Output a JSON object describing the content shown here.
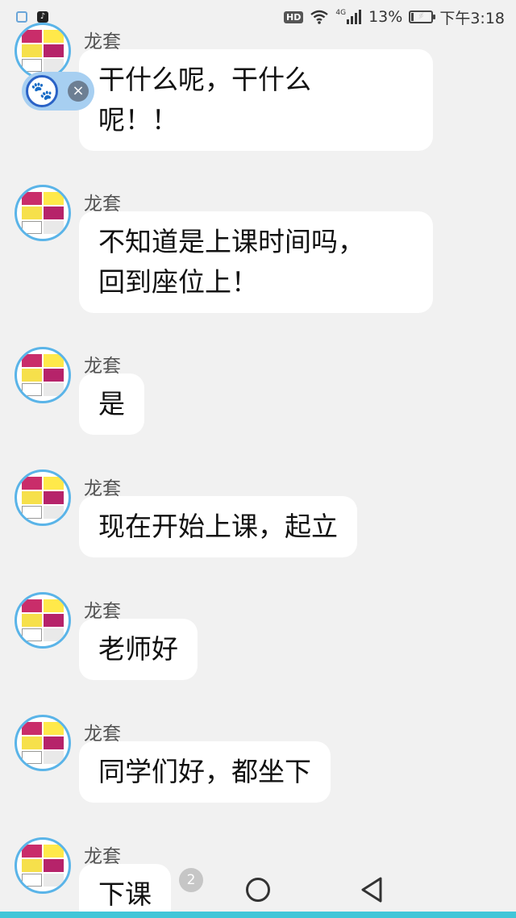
{
  "status_bar": {
    "hd": "HD",
    "network": "4G",
    "battery_percent_text": "13%",
    "battery_level": 0.13,
    "time": "下午3:18"
  },
  "messages": [
    {
      "sender": "龙套",
      "lines": [
        "干什么呢，干什么",
        "呢！！"
      ]
    },
    {
      "sender": "龙套",
      "lines": [
        "不知道是上课时间吗，",
        "回到座位上！"
      ]
    },
    {
      "sender": "龙套",
      "lines": [
        "是"
      ]
    },
    {
      "sender": "龙套",
      "lines": [
        "现在开始上课，起立"
      ]
    },
    {
      "sender": "龙套",
      "lines": [
        "老师好"
      ]
    },
    {
      "sender": "龙套",
      "lines": [
        "同学们好，都坐下"
      ]
    },
    {
      "sender": "龙套",
      "lines": [
        "下课"
      ]
    }
  ],
  "nav": {
    "badge_count": "2"
  },
  "colors": {
    "background": "#f1f1f1",
    "bubble": "#ffffff",
    "avatar_ring": "#5ab4e8",
    "accent_bar": "#41c6d8"
  }
}
